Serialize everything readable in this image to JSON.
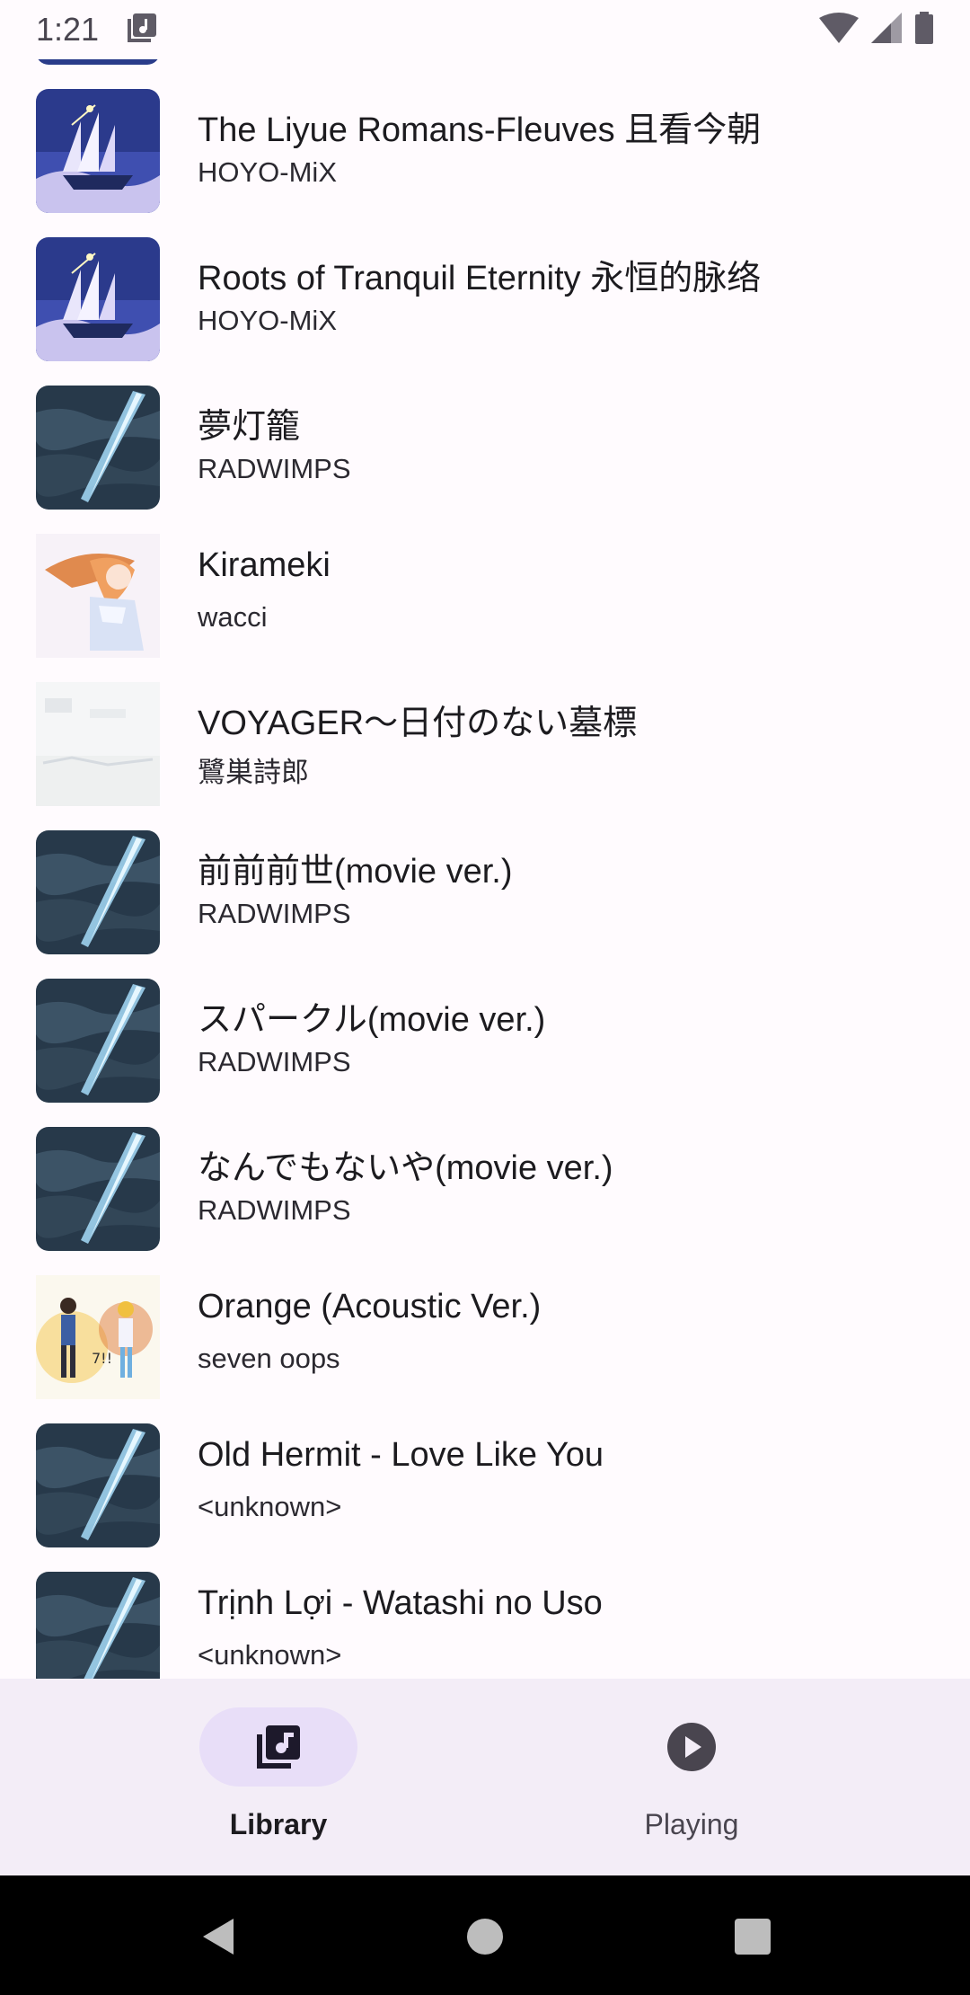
{
  "status_bar": {
    "time": "1:21",
    "icons": [
      "music-notification-icon",
      "wifi-icon",
      "cellular-signal-icon",
      "battery-icon"
    ]
  },
  "songs": [
    {
      "title": "The Liyue Romans-Fleuves 且看今朝",
      "artist": "HOYO-MiX",
      "art": "ship"
    },
    {
      "title": "Roots of Tranquil Eternity 永恒的脉络",
      "artist": "HOYO-MiX",
      "art": "ship"
    },
    {
      "title": "夢灯籠",
      "artist": "RADWIMPS",
      "art": "comet"
    },
    {
      "title": "Kirameki",
      "artist": "wacci",
      "art": "girl"
    },
    {
      "title": "VOYAGER〜日付のない墓標",
      "artist": "鷺巣詩郎",
      "art": "pale"
    },
    {
      "title": "前前前世(movie ver.)",
      "artist": "RADWIMPS",
      "art": "comet"
    },
    {
      "title": "スパークル(movie ver.)",
      "artist": "RADWIMPS",
      "art": "comet"
    },
    {
      "title": "なんでもないや(movie ver.)",
      "artist": "RADWIMPS",
      "art": "comet"
    },
    {
      "title": "Orange (Acoustic Ver.)",
      "artist": "seven oops",
      "art": "couple"
    },
    {
      "title": "Old Hermit - Love Like You",
      "artist": "<unknown>",
      "art": "comet"
    },
    {
      "title": "Trịnh Lợi - Watashi no Uso",
      "artist": "<unknown>",
      "art": "comet"
    }
  ],
  "nav": {
    "library_label": "Library",
    "playing_label": "Playing",
    "active": "library"
  },
  "colors": {
    "background": "#fffbfe",
    "nav_background": "#f3edf7",
    "active_indicator": "#e8def8",
    "icon": "#49454f"
  }
}
